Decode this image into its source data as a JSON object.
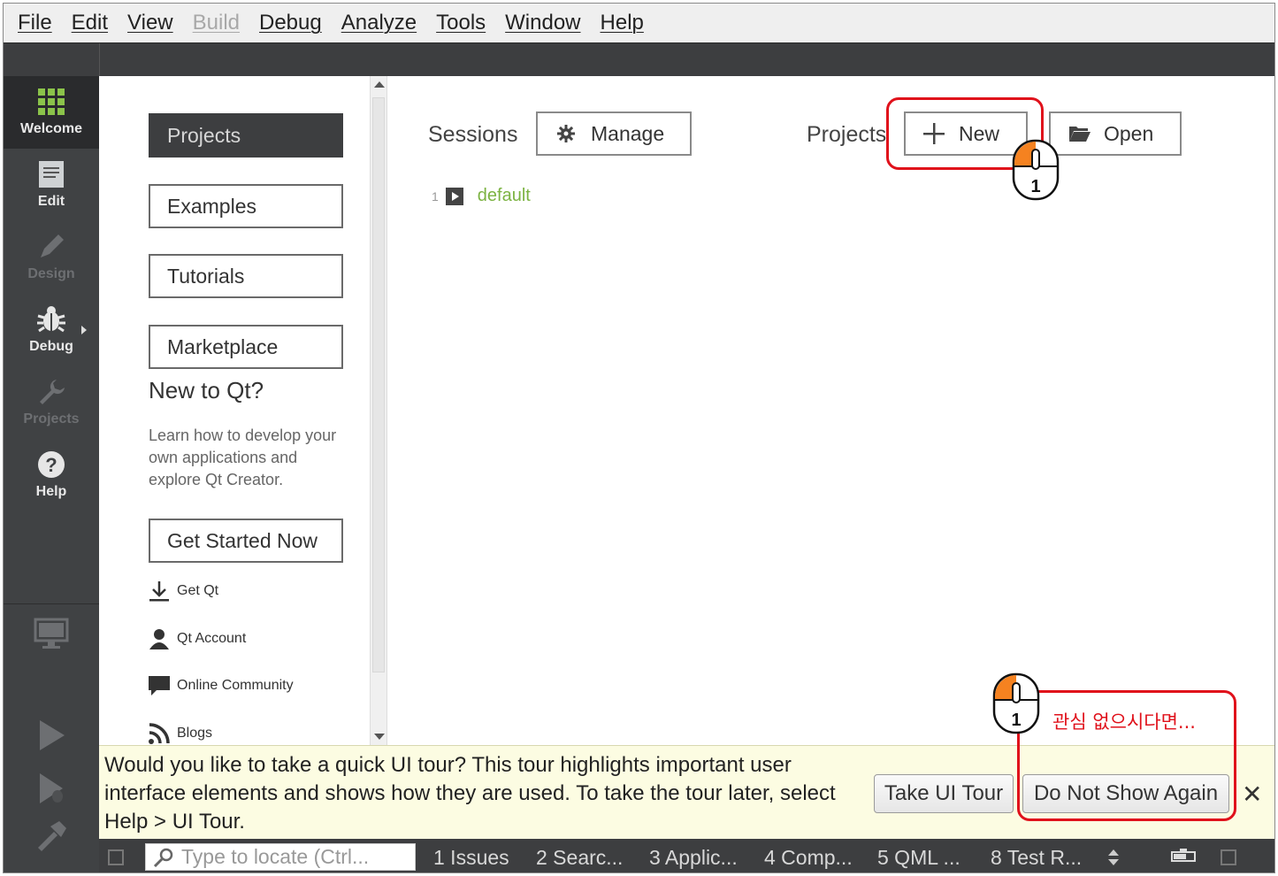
{
  "menu": {
    "items": [
      {
        "label": "File",
        "enabled": true
      },
      {
        "label": "Edit",
        "enabled": true
      },
      {
        "label": "View",
        "enabled": true
      },
      {
        "label": "Build",
        "enabled": false
      },
      {
        "label": "Debug",
        "enabled": true
      },
      {
        "label": "Analyze",
        "enabled": true
      },
      {
        "label": "Tools",
        "enabled": true
      },
      {
        "label": "Window",
        "enabled": true
      },
      {
        "label": "Help",
        "enabled": true
      }
    ]
  },
  "modes": {
    "welcome": {
      "label": "Welcome",
      "icon": "grid-icon"
    },
    "edit": {
      "label": "Edit",
      "icon": "document-icon"
    },
    "design": {
      "label": "Design",
      "icon": "pencil-icon"
    },
    "debug": {
      "label": "Debug",
      "icon": "bug-icon"
    },
    "projects": {
      "label": "Projects",
      "icon": "wrench-icon"
    },
    "help": {
      "label": "Help",
      "icon": "question-icon"
    }
  },
  "welcome_nav": {
    "projects": "Projects",
    "examples": "Examples",
    "tutorials": "Tutorials",
    "marketplace": "Marketplace",
    "new_to_qt": "New to Qt?",
    "learn_text": "Learn how to develop your own applications and explore Qt Creator.",
    "get_started": "Get Started Now",
    "links": {
      "get_qt": "Get Qt",
      "qt_account": "Qt Account",
      "community": "Online Community",
      "blogs": "Blogs"
    }
  },
  "main": {
    "sessions_label": "Sessions",
    "manage_label": "Manage",
    "session": {
      "number": "1",
      "name": "default"
    },
    "projects_label": "Projects",
    "new_label": "New",
    "open_label": "Open"
  },
  "annotations": {
    "step_number": "1",
    "hint_text": "관심 없으시다면...",
    "highlight_color": "#e0111b",
    "mouse_button_color": "#f58220"
  },
  "tour": {
    "text": "Would you like to take a quick UI tour? This tour highlights important user interface elements and shows how they are used. To take the tour later, select Help > UI Tour.",
    "take_tour": "Take UI Tour",
    "do_not_show": "Do Not Show Again",
    "close": "✕"
  },
  "statusbar": {
    "locator_placeholder": "Type to locate (Ctrl...",
    "tabs": [
      "1 Issues",
      "2 Searc...",
      "3 Applic...",
      "4 Comp...",
      "5 QML ...",
      "8 Test R..."
    ]
  },
  "colors": {
    "dark_bg": "#3d3e40",
    "modebar_bg": "#404244",
    "session_green": "#7cb342",
    "tour_bg": "#fcfce2"
  }
}
